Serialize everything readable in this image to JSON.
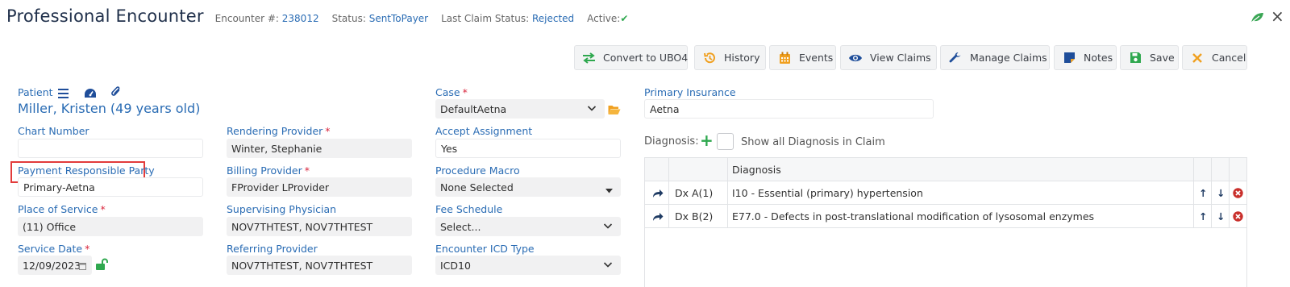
{
  "header": {
    "title": "Professional Encounter",
    "encounter_label": "Encounter #:",
    "encounter_value": "238012",
    "status_label": "Status:",
    "status_value": "SentToPayer",
    "claim_status_label": "Last Claim Status:",
    "claim_status_value": "Rejected",
    "active_label": "Active:",
    "active_value": "✔"
  },
  "toolbar": {
    "convert_label": "Convert to UBO4",
    "history_label": "History",
    "events_label": "Events",
    "view_claims_label": "View Claims",
    "manage_claims_label": "Manage Claims",
    "notes_label": "Notes",
    "save_label": "Save",
    "cancel_label": "Cancel"
  },
  "patient": {
    "label": "Patient",
    "name": "Miller, Kristen (49 years old)"
  },
  "fields": {
    "chart_number": {
      "label": "Chart Number",
      "value": ""
    },
    "payment_responsible_party": {
      "label": "Payment Responsible Party",
      "value": "Primary-Aetna"
    },
    "place_of_service": {
      "label": "Place of Service",
      "value": "(11) Office"
    },
    "service_date": {
      "label": "Service Date",
      "value": "12/09/2023"
    },
    "rendering_provider": {
      "label": "Rendering Provider",
      "value": "Winter, Stephanie"
    },
    "billing_provider": {
      "label": "Billing Provider",
      "value": "FProvider LProvider"
    },
    "supervising_physician": {
      "label": "Supervising Physician",
      "value": "NOV7THTEST, NOV7THTEST"
    },
    "referring_provider": {
      "label": "Referring Provider",
      "value": "NOV7THTEST, NOV7THTEST"
    },
    "case": {
      "label": "Case",
      "value": "DefaultAetna"
    },
    "accept_assignment": {
      "label": "Accept Assignment",
      "value": "Yes"
    },
    "procedure_macro": {
      "label": "Procedure Macro",
      "value": "None Selected"
    },
    "fee_schedule": {
      "label": "Fee Schedule",
      "value": "Select..."
    },
    "encounter_icd_type": {
      "label": "Encounter ICD Type",
      "value": "ICD10"
    },
    "primary_insurance": {
      "label": "Primary Insurance",
      "value": "Aetna"
    },
    "required_marker": "*"
  },
  "diagnosis": {
    "label": "Diagnosis:",
    "show_all_label": "Show all Diagnosis in Claim",
    "column_header": "Diagnosis",
    "rows": [
      {
        "code": "Dx A(1)",
        "description": "I10 - Essential (primary) hypertension"
      },
      {
        "code": "Dx B(2)",
        "description": "E77.0 - Defects in post-translational modification of lysosomal enzymes"
      }
    ]
  },
  "icons": {
    "close": "×",
    "up": "↑",
    "down": "↓",
    "plus": "+"
  },
  "colors": {
    "link_blue": "#2a6cb4",
    "required_red": "#d9263d",
    "active_green": "#2fa84f",
    "highlight_red": "#e23b3b",
    "delete_red": "#c9302c",
    "history_orange": "#f0a020",
    "notes_blue": "#1f4e9a"
  }
}
